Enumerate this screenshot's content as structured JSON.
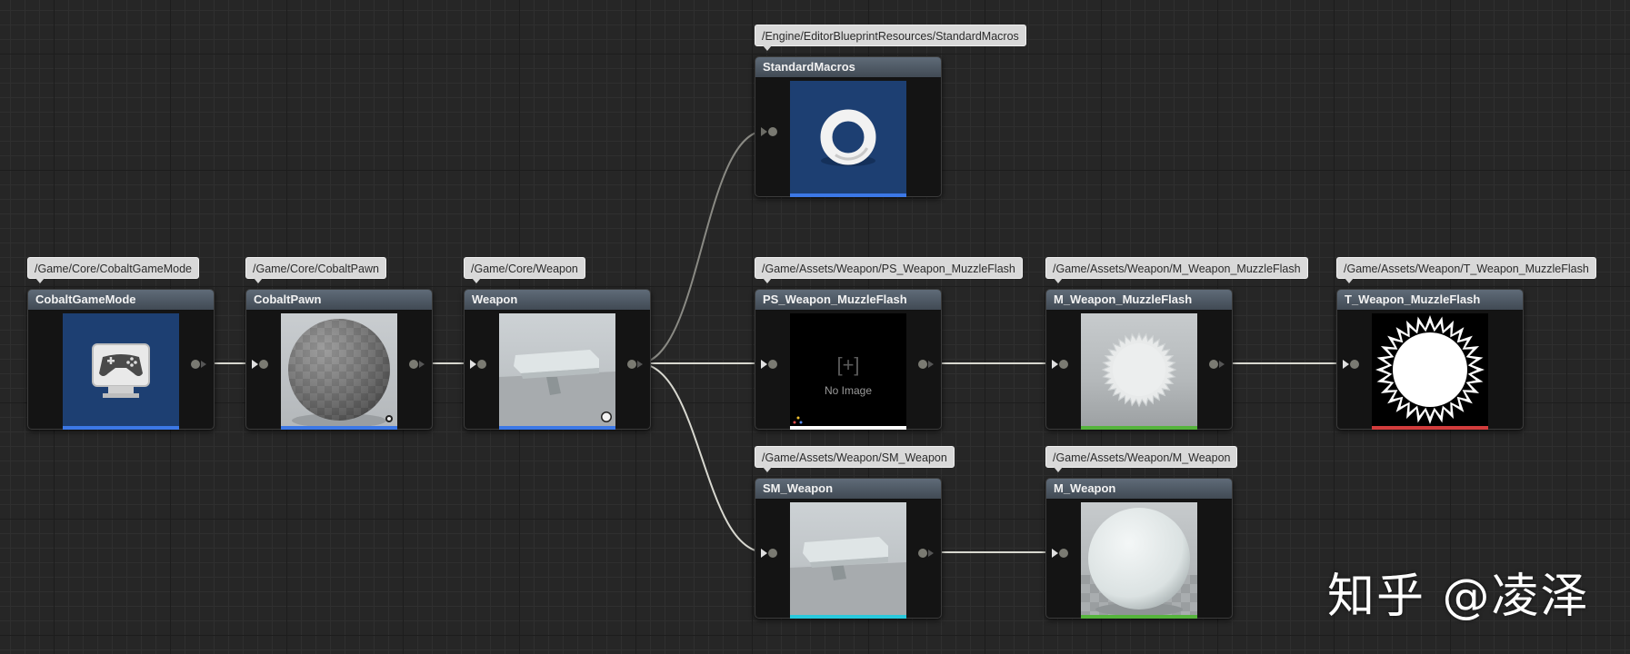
{
  "nodes": [
    {
      "name": "CobaltGameMode",
      "path": "/Game/Core/CobaltGameMode",
      "thumbnail": "gamepad-icon",
      "bar_color": "#3c78e6"
    },
    {
      "name": "CobaltPawn",
      "path": "/Game/Core/CobaltPawn",
      "thumbnail": "checker-sphere",
      "bar_color": "#3c78e6"
    },
    {
      "name": "Weapon",
      "path": "/Game/Core/Weapon",
      "thumbnail": "weapon-mesh",
      "bar_color": "#3c78e6"
    },
    {
      "name": "StandardMacros",
      "path": "/Engine/EditorBlueprintResources/StandardMacros",
      "thumbnail": "torus-icon",
      "bar_color": "#3c78e6"
    },
    {
      "name": "PS_Weapon_MuzzleFlash",
      "path": "/Game/Assets/Weapon/PS_Weapon_MuzzleFlash",
      "thumbnail": "no-image",
      "no_image_symbol": "[+]",
      "no_image_label": "No Image",
      "bar_color": "#ffffff"
    },
    {
      "name": "M_Weapon_MuzzleFlash",
      "path": "/Game/Assets/Weapon/M_Weapon_MuzzleFlash",
      "thumbnail": "starburst-preview",
      "bar_color": "#55b43c"
    },
    {
      "name": "T_Weapon_MuzzleFlash",
      "path": "/Game/Assets/Weapon/T_Weapon_MuzzleFlash",
      "thumbnail": "starburst-texture",
      "bar_color": "#d23c3c"
    },
    {
      "name": "SM_Weapon",
      "path": "/Game/Assets/Weapon/SM_Weapon",
      "thumbnail": "weapon-mesh",
      "bar_color": "#28c8dc"
    },
    {
      "name": "M_Weapon",
      "path": "/Game/Assets/Weapon/M_Weapon",
      "thumbnail": "white-sphere",
      "bar_color": "#55b43c"
    }
  ],
  "connections": [
    {
      "from": "CobaltGameMode",
      "to": "CobaltPawn"
    },
    {
      "from": "CobaltPawn",
      "to": "Weapon"
    },
    {
      "from": "Weapon",
      "to": "StandardMacros"
    },
    {
      "from": "Weapon",
      "to": "PS_Weapon_MuzzleFlash"
    },
    {
      "from": "Weapon",
      "to": "SM_Weapon"
    },
    {
      "from": "PS_Weapon_MuzzleFlash",
      "to": "M_Weapon_MuzzleFlash"
    },
    {
      "from": "M_Weapon_MuzzleFlash",
      "to": "T_Weapon_MuzzleFlash"
    },
    {
      "from": "SM_Weapon",
      "to": "M_Weapon"
    }
  ],
  "watermark": "知乎 @凌泽",
  "wire_color": "#d8d8d0"
}
